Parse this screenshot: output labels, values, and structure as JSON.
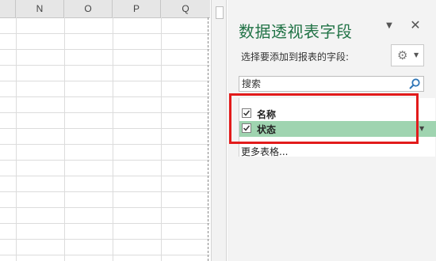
{
  "sheet": {
    "columns": [
      "N",
      "O",
      "P",
      "Q"
    ]
  },
  "pane": {
    "title": "数据透视表字段",
    "subtitle": "选择要添加到报表的字段:",
    "search_placeholder": "搜索",
    "fields": [
      {
        "label": "名称",
        "checked": true
      },
      {
        "label": "状态",
        "checked": true
      }
    ],
    "more_tables": "更多表格...",
    "accent_color": "#217346",
    "selection_color": "#9fd4b0",
    "highlight_color": "#e21b1b"
  }
}
